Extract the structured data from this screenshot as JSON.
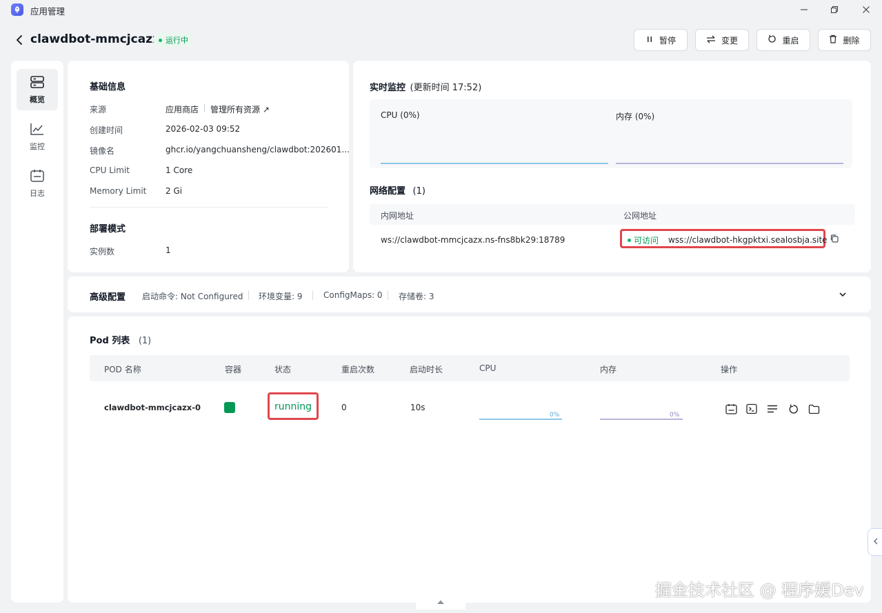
{
  "window": {
    "title": "应用管理"
  },
  "header": {
    "app_name": "clawdbot-mmcjcazx",
    "status": "运行中",
    "buttons": {
      "pause": "暂停",
      "change": "变更",
      "restart": "重启",
      "delete": "删除"
    }
  },
  "sidebar": {
    "items": [
      {
        "label": "概览",
        "icon": "server-icon",
        "active": true
      },
      {
        "label": "监控",
        "icon": "line-chart-icon",
        "active": false
      },
      {
        "label": "日志",
        "icon": "calendar-log-icon",
        "active": false
      }
    ]
  },
  "basic_info": {
    "title": "基础信息",
    "rows": [
      {
        "label": "来源",
        "value": "应用商店",
        "link": "管理所有资源"
      },
      {
        "label": "创建时间",
        "value": "2026-02-03 09:52"
      },
      {
        "label": "镜像名",
        "value": "ghcr.io/yangchuansheng/clawdbot:202601..."
      },
      {
        "label": "CPU Limit",
        "value": "1 Core"
      },
      {
        "label": "Memory Limit",
        "value": "2 Gi"
      }
    ],
    "deploy_title": "部署模式",
    "deploy_rows": [
      {
        "label": "实例数",
        "value": "1"
      }
    ]
  },
  "monitor": {
    "title": "实时监控",
    "updated": "(更新时间  17:52)",
    "cpu_label": "CPU  (0%)",
    "mem_label": "内存  (0%)",
    "cpu_color": "#8ec7ea",
    "mem_color": "#b9b3dc"
  },
  "network": {
    "title": "网络配置",
    "count": "(1)",
    "col_internal": "内网地址",
    "col_public": "公网地址",
    "internal_addr": "ws://clawdbot-mmcjcazx.ns-fns8bk29:18789",
    "access_status": "可访问",
    "public_addr": "wss://clawdbot-hkgpktxi.sealosbja.site"
  },
  "advanced": {
    "title": "高级配置",
    "items": [
      "启动命令: Not Configured",
      "环境变量: 9",
      "ConfigMaps: 0",
      "存储卷: 3"
    ]
  },
  "pods": {
    "title": "Pod 列表",
    "count": "(1)",
    "columns": [
      "POD 名称",
      "容器",
      "状态",
      "重启次数",
      "启动时长",
      "CPU",
      "内存",
      "操作"
    ],
    "rows": [
      {
        "name": "clawdbot-mmcjcazx-0",
        "container_color": "#039855",
        "status": "running",
        "restarts": "0",
        "uptime": "10s",
        "cpu": "0%",
        "cpu_level": 0,
        "mem": "0%",
        "mem_level": 0
      }
    ],
    "actions": [
      "logs-icon",
      "terminal-icon",
      "details-icon",
      "restart-icon",
      "folder-icon"
    ]
  },
  "watermark": "掘金技术社区 @ 程序媛Dev"
}
